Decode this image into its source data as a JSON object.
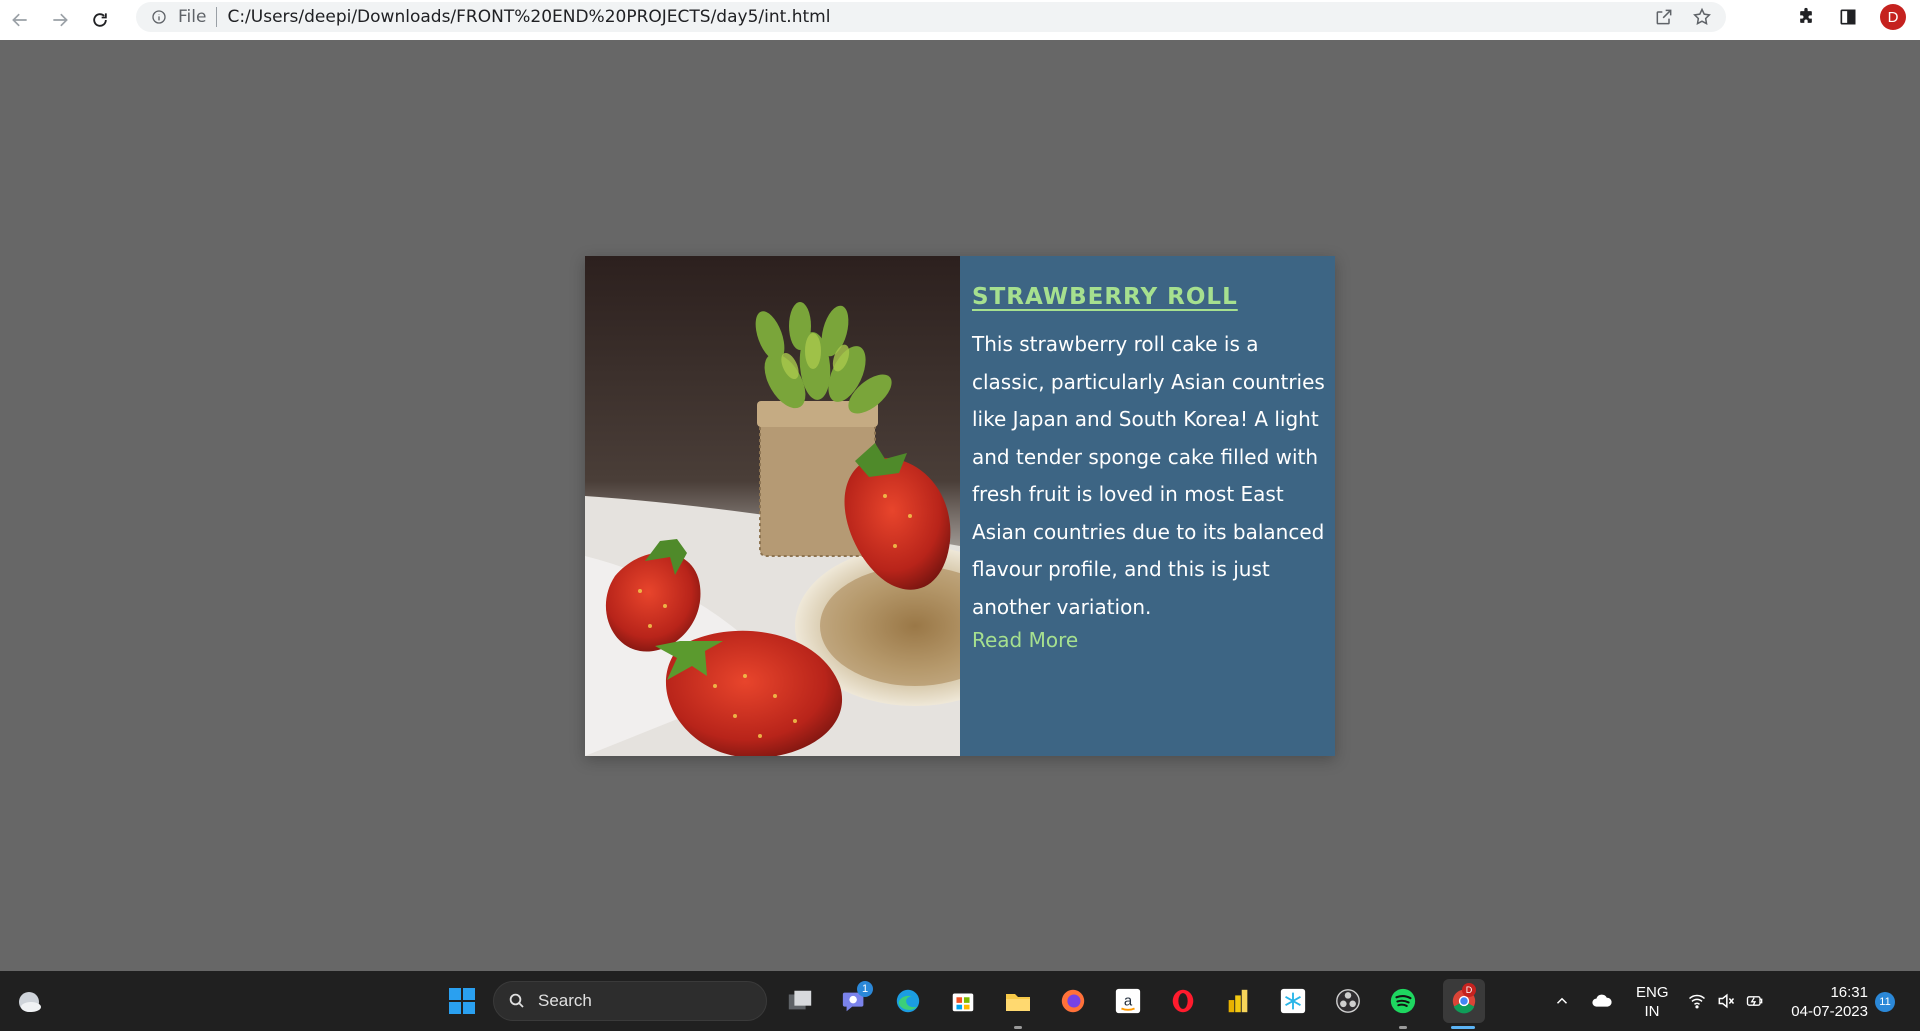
{
  "browser": {
    "scheme_label": "File",
    "url": "C:/Users/deepi/Downloads/FRONT%20END%20PROJECTS/day5/int.html",
    "profile_initial": "D"
  },
  "card": {
    "title": "STRAWBERRY ROLL",
    "description": "This strawberry roll cake is a classic, particularly Asian countries like Japan and South Korea! A light and tender sponge cake filled with fresh fruit is loved in most East Asian countries due to its balanced flavour profile, and this is just another variation.",
    "read_more": "Read More"
  },
  "taskbar": {
    "search_label": "Search",
    "teams_badge": "1",
    "chrome_badge": "D",
    "lang_line1": "ENG",
    "lang_line2": "IN",
    "time": "16:31",
    "date": "04-07-2023",
    "notification_count": "11"
  },
  "colors": {
    "page_bg": "#676767",
    "card_panel": "#3d6584",
    "accent_green": "#a6e08f"
  }
}
